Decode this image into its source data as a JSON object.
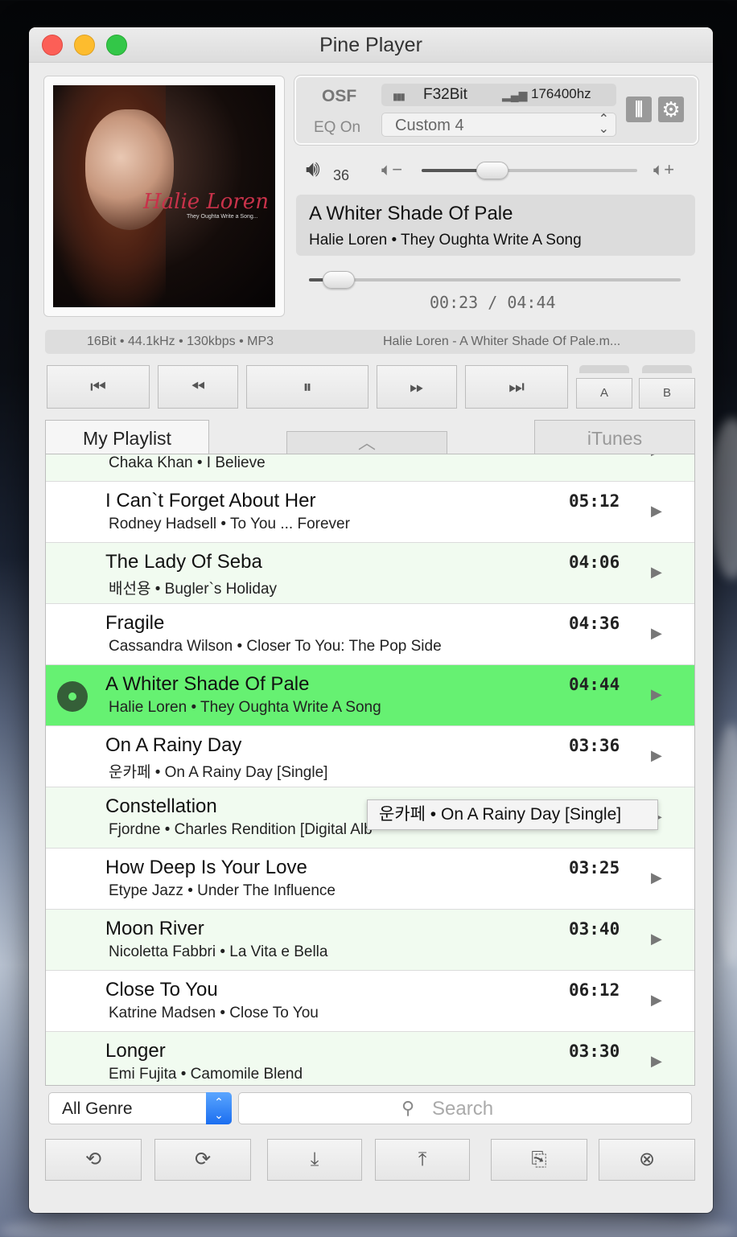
{
  "window": {
    "title": "Pine Player"
  },
  "album_art": {
    "artist_script": "Halie Loren",
    "album_caption": "They Oughta Write a Song..."
  },
  "status": {
    "engine": "OSF",
    "eq_state": "EQ On",
    "bit_format": "F32Bit",
    "sample_rate": "176400hz",
    "eq_preset": "Custom 4"
  },
  "volume": {
    "value": "36",
    "level_percent": 33
  },
  "now_playing": {
    "title": "A Whiter Shade Of Pale",
    "subtitle": "Halie Loren • They Oughta Write A Song",
    "time": "00:23 / 04:44",
    "progress_fraction": 0.081
  },
  "info_bar": {
    "format": "16Bit • 44.1kHz • 130kbps • MP3",
    "filename": "Halie Loren - A Whiter Shade Of Pale.m..."
  },
  "transport": {
    "a_label": "A",
    "b_label": "B"
  },
  "tabs": {
    "playlist": "My Playlist",
    "itunes": "iTunes"
  },
  "playlist": [
    {
      "title": "",
      "subtitle": "Chaka Khan • I Believe",
      "duration": ""
    },
    {
      "title": "I Can`t Forget About Her",
      "subtitle": "Rodney Hadsell • To You ... Forever",
      "duration": "05:12"
    },
    {
      "title": "The Lady Of Seba",
      "subtitle": "배선용 • Bugler`s Holiday",
      "duration": "04:06"
    },
    {
      "title": "Fragile",
      "subtitle": "Cassandra Wilson • Closer To You: The Pop Side",
      "duration": "04:36"
    },
    {
      "title": "A Whiter Shade Of Pale",
      "subtitle": "Halie Loren • They Oughta Write A Song",
      "duration": "04:44"
    },
    {
      "title": "On A Rainy Day",
      "subtitle": "운카페 • On A Rainy Day [Single]",
      "duration": "03:36"
    },
    {
      "title": "Constellation",
      "subtitle": "Fjordne • Charles Rendition [Digital Alb",
      "duration": ""
    },
    {
      "title": "How Deep Is Your Love",
      "subtitle": "Etype Jazz • Under The Influence",
      "duration": "03:25"
    },
    {
      "title": "Moon River",
      "subtitle": "Nicoletta Fabbri • La Vita e Bella",
      "duration": "03:40"
    },
    {
      "title": "Close To You",
      "subtitle": "Katrine Madsen • Close To You",
      "duration": "06:12"
    },
    {
      "title": "Longer",
      "subtitle": "Emi Fujita • Camomile Blend",
      "duration": "03:30"
    }
  ],
  "tooltip": "운카페 • On A Rainy Day [Single]",
  "genre": {
    "selected": "All Genre"
  },
  "search": {
    "placeholder": "Search"
  },
  "colors": {
    "playing_row": "#66f172",
    "alt_row": "#f1fbf0",
    "accent_blue": "#1b6ef0"
  }
}
